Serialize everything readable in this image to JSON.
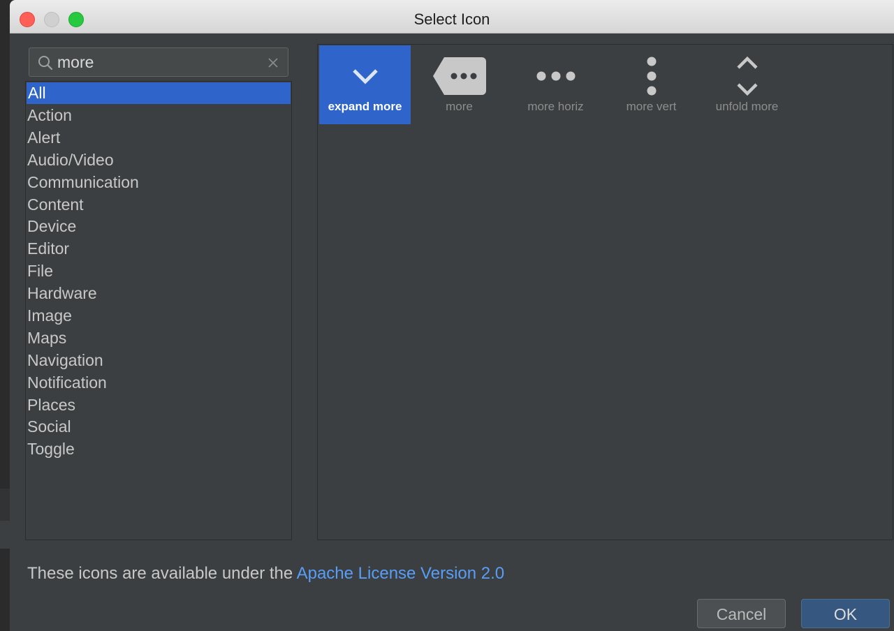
{
  "window": {
    "title": "Select Icon",
    "controls": [
      "close",
      "minimize",
      "maximize"
    ]
  },
  "search": {
    "value": "more",
    "icon": "search-icon",
    "clear_icon": "clear-icon"
  },
  "categories": {
    "selected": "All",
    "items": [
      {
        "label": "All"
      },
      {
        "label": "Action"
      },
      {
        "label": "Alert"
      },
      {
        "label": "Audio/Video"
      },
      {
        "label": "Communication"
      },
      {
        "label": "Content"
      },
      {
        "label": "Device"
      },
      {
        "label": "Editor"
      },
      {
        "label": "File"
      },
      {
        "label": "Hardware"
      },
      {
        "label": "Image"
      },
      {
        "label": "Maps"
      },
      {
        "label": "Navigation"
      },
      {
        "label": "Notification"
      },
      {
        "label": "Places"
      },
      {
        "label": "Social"
      },
      {
        "label": "Toggle"
      }
    ]
  },
  "icons": {
    "selected": "expand more",
    "items": [
      {
        "label": "expand more",
        "icon": "expand-more-icon"
      },
      {
        "label": "more",
        "icon": "more-icon"
      },
      {
        "label": "more horiz",
        "icon": "more-horiz-icon"
      },
      {
        "label": "more vert",
        "icon": "more-vert-icon"
      },
      {
        "label": "unfold more",
        "icon": "unfold-more-icon"
      }
    ]
  },
  "footer": {
    "license_text": "These icons are available under the ",
    "license_link": "Apache License Version 2.0",
    "cancel_label": "Cancel",
    "ok_label": "OK"
  },
  "colors": {
    "dialog_bg": "#3c3f41",
    "selection": "#2f65ca",
    "link": "#589df6",
    "ok_button": "#365880"
  }
}
